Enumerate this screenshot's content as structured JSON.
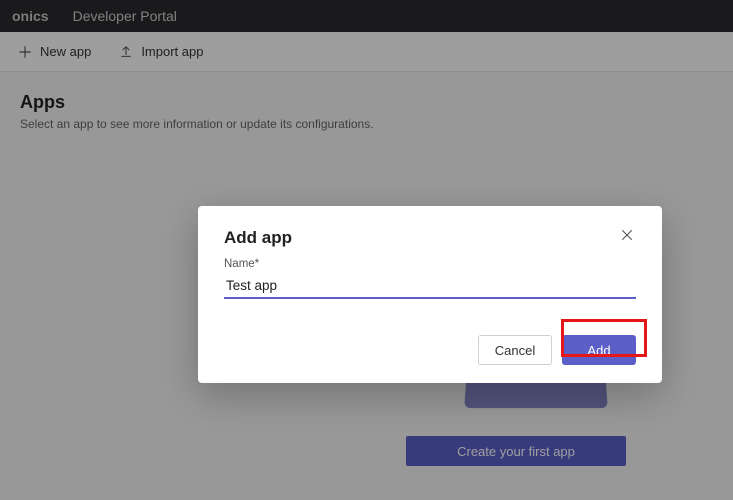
{
  "header": {
    "brand": "onics",
    "portal": "Developer Portal"
  },
  "toolbar": {
    "new_app": "New app",
    "import_app": "Import app"
  },
  "page": {
    "title": "Apps",
    "subtitle": "Select an app to see more information or update its configurations."
  },
  "empty_state": {
    "create_button": "Create your first app"
  },
  "dialog": {
    "title": "Add app",
    "name_label": "Name*",
    "name_value": "Test app",
    "cancel": "Cancel",
    "add": "Add"
  }
}
